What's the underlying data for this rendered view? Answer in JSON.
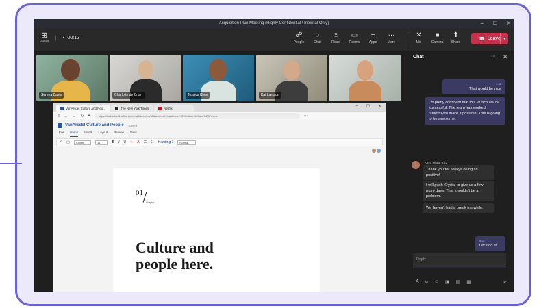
{
  "titlebar": {
    "title": "Acquisition Plan Meeting (Highly Confidential \\ Internal Only)",
    "minimize": "–",
    "maximize": "☐",
    "close": "✕"
  },
  "toolbar": {
    "views_label": "Views",
    "timer": "00:12",
    "buttons": [
      {
        "label": "People",
        "icon": "people-icon",
        "glyph": "☍"
      },
      {
        "label": "Chat",
        "icon": "chat-icon",
        "glyph": "◌"
      },
      {
        "label": "React",
        "icon": "react-icon",
        "glyph": "☺"
      },
      {
        "label": "Rooms",
        "icon": "rooms-icon",
        "glyph": "▭"
      },
      {
        "label": "Apps",
        "icon": "apps-icon",
        "glyph": "+"
      },
      {
        "label": "More",
        "icon": "more-icon",
        "glyph": "···"
      }
    ],
    "media": [
      {
        "label": "Mic",
        "icon": "mic-off-icon",
        "glyph": "✕"
      },
      {
        "label": "Camera",
        "icon": "camera-icon",
        "glyph": "■"
      },
      {
        "label": "Share",
        "icon": "share-icon",
        "glyph": "⬆"
      }
    ],
    "leave_label": "Leave"
  },
  "participants": [
    {
      "name": "Serena Davis"
    },
    {
      "name": "Charlotte de Crum"
    },
    {
      "name": "Jessica Kline"
    },
    {
      "name": "Kat Larsson"
    },
    {
      "name": ""
    }
  ],
  "browser": {
    "tabs": [
      "VanArsdel Culture and Peo...",
      "The New York Times",
      "Netflix"
    ],
    "url": "https://outlook.cdf.office.com/mail/deeplink?Attachment=VanArsdel%20Culture%20and%20People",
    "doc_title": "VanArsdel Culture and People",
    "doc_status": "- Saved",
    "ribbon_tabs": [
      "File",
      "Home",
      "Insert",
      "Layout",
      "Review",
      "View"
    ],
    "font": "Calibri",
    "size": "11",
    "style_label": "Heading 1",
    "normal_label": "Normal",
    "chapter_num": "01",
    "chapter_label": "Chapter",
    "doc_heading": "Culture and people here."
  },
  "chat": {
    "header": "Chat",
    "my_msg1": {
      "time": "9:02",
      "text": "That would be nice"
    },
    "my_msg2": {
      "text": "I'm pretty confident that this launch will be successful. The team has worked tirelessly to make it possible. This is going to be awesome."
    },
    "other": {
      "name": "Kayo Miwa",
      "time": "9:22",
      "msgs": [
        "Thank you for always being so positive!",
        "I will push Krystal to give us a few more days. That shouldn't be a problem.",
        "We haven't had a break in awhile."
      ]
    },
    "my_msg3": {
      "time": "9:22",
      "text": "Let's do it!"
    },
    "reply_placeholder": "Reply"
  }
}
